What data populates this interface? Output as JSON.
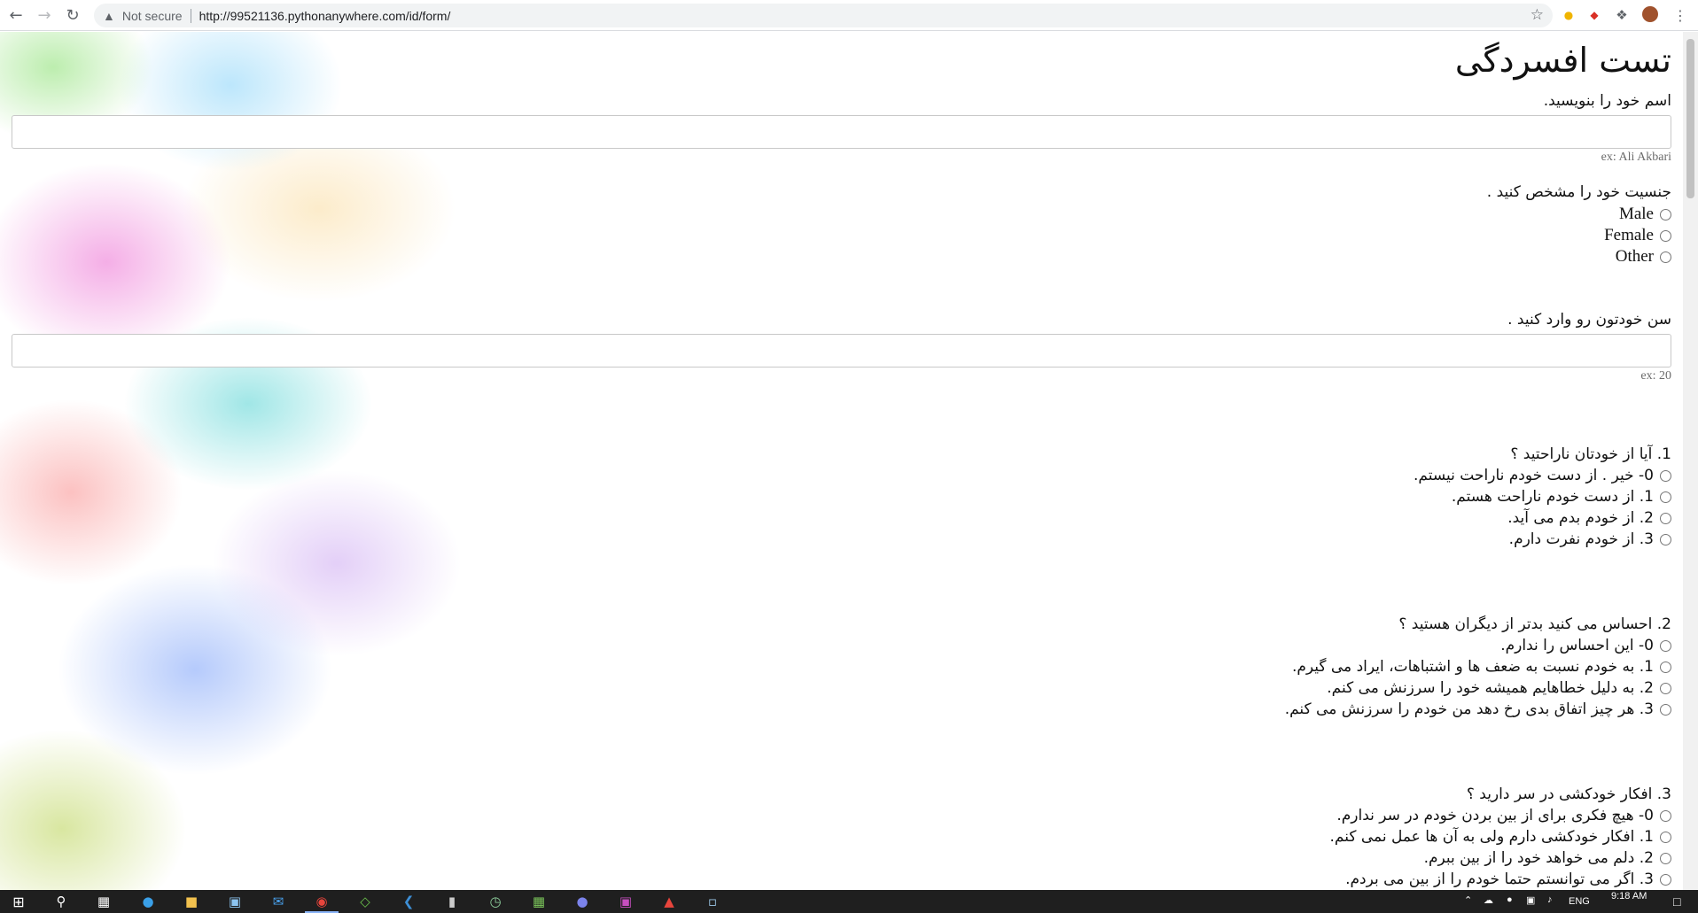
{
  "browser": {
    "security_label": "Not secure",
    "url": "http://99521136.pythonanywhere.com/id/form/"
  },
  "form": {
    "title": "تست افسردگی",
    "name": {
      "label": "اسم خود را بنویسید.",
      "hint": "ex: Ali Akbari"
    },
    "gender": {
      "label": "جنسیت خود را مشخص کنید .",
      "options": [
        "Male",
        "Female",
        "Other"
      ]
    },
    "age": {
      "label": "سن خودتون رو وارد کنید .",
      "hint": "ex: 20"
    },
    "questions": [
      {
        "text": "1. آیا از خودتان ناراحتید ؟",
        "options": [
          "0- خیر . از دست خودم ناراحت نیستم.",
          "1. از دست خودم ناراحت هستم.",
          "2. از خودم بدم می آید.",
          "3. از خودم نفرت دارم."
        ]
      },
      {
        "text": "2. احساس می کنید بدتر از دیگران هستید ؟",
        "options": [
          "0- این احساس را ندارم.",
          "1. به خودم نسبت به ضعف ها و اشتباهات، ایراد می گیرم.",
          "2. به دلیل خطاهایم همیشه خود را سرزنش می کنم.",
          "3. هر چیز اتفاق بدی رخ دهد من خودم را سرزنش می کنم."
        ]
      },
      {
        "text": "3. افکار خودکشی در سر دارید ؟",
        "options": [
          "0- هیچ فکری برای از بین بردن خودم در سر ندارم.",
          "1. افکار خودکشی دارم ولی به آن ها عمل نمی کنم.",
          "2. دلم می خواهد خود را از بین ببرم.",
          "3. اگر می توانستم حتما خودم را از بین می بردم."
        ]
      }
    ]
  },
  "taskbar": {
    "language": "ENG",
    "time": "9:18 AM"
  }
}
